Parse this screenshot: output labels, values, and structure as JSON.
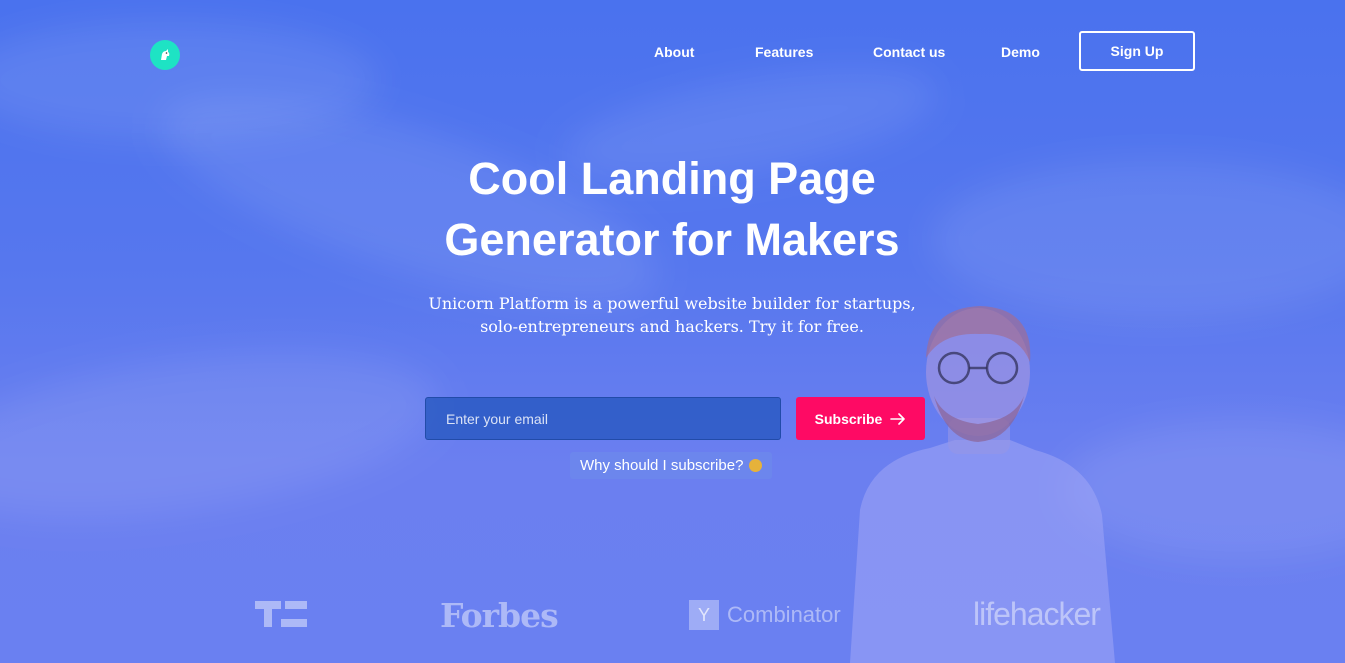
{
  "nav": {
    "links": [
      "About",
      "Features",
      "Contact us",
      "Demo"
    ],
    "signup_label": "Sign Up"
  },
  "hero": {
    "title": "Cool Landing Page Generator for Makers",
    "subtitle_line1": "Unicorn Platform is a powerful website builder for startups,",
    "subtitle_line2": "solo-entrepreneurs and hackers. Try it for free."
  },
  "form": {
    "email_placeholder": "Enter your email",
    "email_value": "",
    "subscribe_label": "Subscribe",
    "why_label": "Why should I subscribe?"
  },
  "press_logos": [
    {
      "name": "techcrunch-logo",
      "text": ""
    },
    {
      "name": "forbes-logo",
      "text": "Forbes"
    },
    {
      "name": "ycombinator-logo",
      "text": "Combinator",
      "mark": "Y"
    },
    {
      "name": "lifehacker-logo",
      "text": "lifehacker"
    }
  ],
  "colors": {
    "hero_blue": "#4a72ee",
    "accent_pink": "#fe0a64",
    "logo_teal": "#1ee3c4"
  },
  "icons": [
    "unicorn-icon",
    "arrow-right-icon",
    "thinking-face-icon"
  ]
}
